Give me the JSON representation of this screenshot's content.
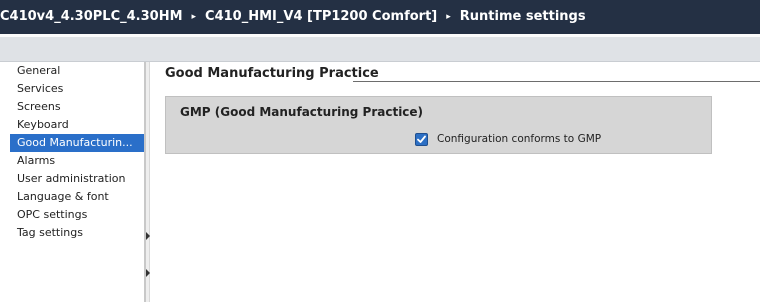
{
  "breadcrumb": {
    "items": [
      "C410v4_4.30PLC_4.30HM",
      "C410_HMI_V4 [TP1200 Comfort]",
      "Runtime settings"
    ],
    "separator": "▸"
  },
  "sidebar": {
    "items": [
      {
        "label": "General",
        "selected": false
      },
      {
        "label": "Services",
        "selected": false
      },
      {
        "label": "Screens",
        "selected": false
      },
      {
        "label": "Keyboard",
        "selected": false
      },
      {
        "label": "Good Manufacturin...",
        "selected": true
      },
      {
        "label": "Alarms",
        "selected": false
      },
      {
        "label": "User administration",
        "selected": false
      },
      {
        "label": "Language & font",
        "selected": false
      },
      {
        "label": "OPC settings",
        "selected": false
      },
      {
        "label": "Tag settings",
        "selected": false
      }
    ]
  },
  "main": {
    "section_title": "Good Manufacturing Practice",
    "group": {
      "title": "GMP (Good Manufacturing Practice)",
      "checkbox": {
        "label": "Configuration conforms to GMP",
        "checked": true
      }
    }
  },
  "colors": {
    "title_bar": "#243044",
    "selected_item": "#2a6fc9",
    "checkbox": "#2c6fc4",
    "group_background": "#d6d6d6"
  }
}
